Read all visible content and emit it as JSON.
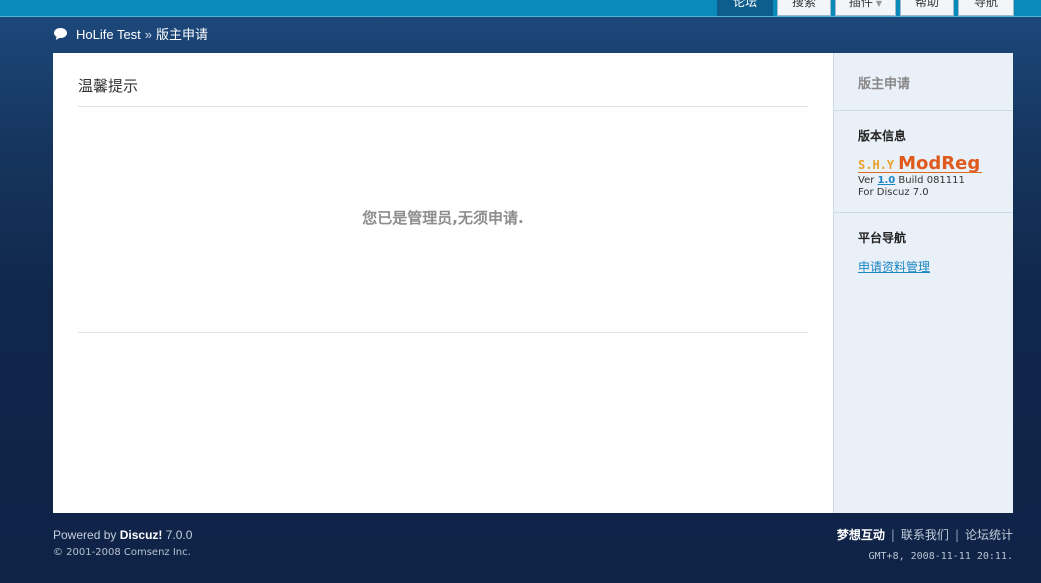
{
  "nav": {
    "items": [
      {
        "label": "论坛",
        "active": true
      },
      {
        "label": "搜索",
        "active": false
      },
      {
        "label": "插件",
        "active": false,
        "has_dropdown": true
      },
      {
        "label": "帮助",
        "active": false
      },
      {
        "label": "导航",
        "active": false
      }
    ]
  },
  "breadcrumb": {
    "site": "HoLife Test",
    "separator": "»",
    "current": "版主申请"
  },
  "notice": {
    "title": "温馨提示",
    "message": "您已是管理员,无须申请."
  },
  "sidebar": {
    "header": "版主申请",
    "version_section": {
      "title": "版本信息",
      "logo_prefix": "S.H.Y",
      "logo_name": "ModReg",
      "ver_label": "Ver",
      "ver_number": "1.0",
      "build_label": "Build 081111",
      "platform": "For Discuz 7.0"
    },
    "nav_section": {
      "title": "平台导航",
      "link": "申请资料管理"
    }
  },
  "footer": {
    "powered_prefix": "Powered by",
    "powered_brand": "Discuz!",
    "powered_version": "7.0.0",
    "copyright": "© 2001-2008 Comsenz Inc.",
    "links": [
      "梦想互动",
      "联系我们",
      "论坛统计"
    ],
    "timestamp": "GMT+8, 2008-11-11 20:11."
  },
  "colors": {
    "topbar": "#0a8ab8",
    "active_tab": "#0d5e8c",
    "logo_orange": "#e05a1e",
    "link_blue": "#1a86c4"
  }
}
